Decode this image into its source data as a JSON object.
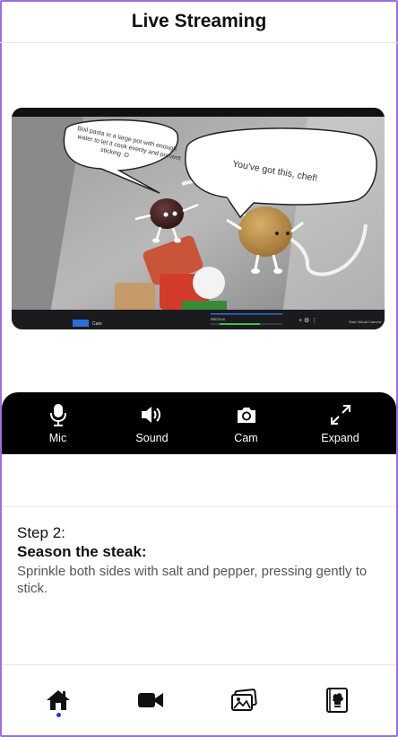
{
  "header": {
    "title": "Live Streaming"
  },
  "video": {
    "bubble_left": "Boil pasta in a large pot with enough water to let it cook evenly and prevent sticking :D",
    "bubble_right": "You've got this, chef!",
    "toolbar_left": "Cam",
    "toolbar_mid": "Mic/Aux",
    "toolbar_right": "Start Virtual Camera"
  },
  "controls": [
    {
      "label": "Mic",
      "icon": "microphone-icon"
    },
    {
      "label": "Sound",
      "icon": "speaker-icon"
    },
    {
      "label": "Cam",
      "icon": "camera-icon"
    },
    {
      "label": "Expand",
      "icon": "expand-icon"
    }
  ],
  "step": {
    "number": "Step 2:",
    "title": "Season the steak:",
    "description": "Sprinkle both sides with salt and pepper, pressing gently to stick."
  },
  "nav": [
    {
      "name": "home-icon",
      "active": true
    },
    {
      "name": "video-camera-icon",
      "active": false
    },
    {
      "name": "gallery-icon",
      "active": false
    },
    {
      "name": "cookbook-icon",
      "active": false
    }
  ],
  "colors": {
    "accent": "#1a3ad8",
    "frame": "#9b6fe0",
    "control_bar": "#000000"
  }
}
